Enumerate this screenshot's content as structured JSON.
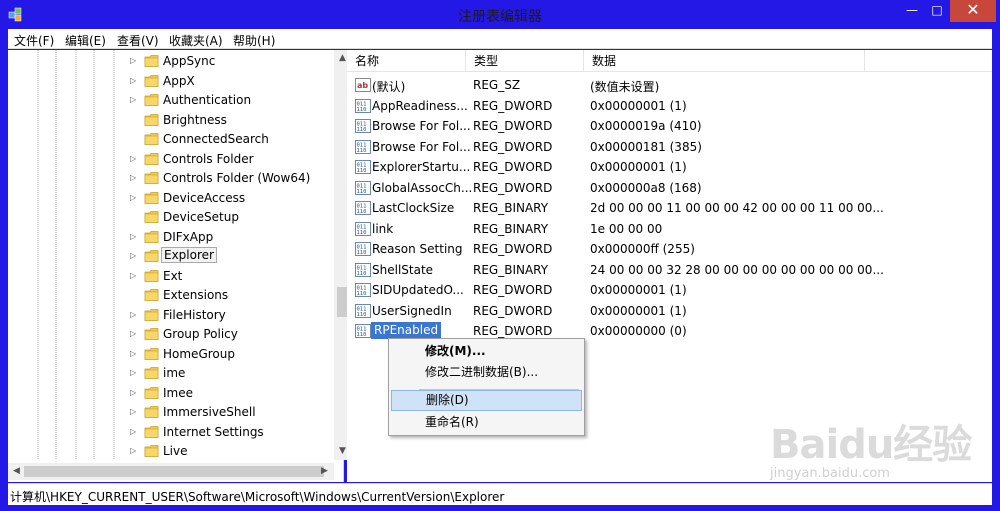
{
  "window": {
    "title": "注册表编辑器",
    "buttons": {
      "minimize": "—",
      "maximize": "□",
      "close": "✕"
    }
  },
  "menubar": {
    "items": [
      "文件(F)",
      "编辑(E)",
      "查看(V)",
      "收藏夹(A)",
      "帮助(H)"
    ]
  },
  "tree": {
    "items": [
      {
        "label": "AppSync",
        "expandable": true
      },
      {
        "label": "AppX",
        "expandable": true
      },
      {
        "label": "Authentication",
        "expandable": true
      },
      {
        "label": "Brightness",
        "expandable": false
      },
      {
        "label": "ConnectedSearch",
        "expandable": false
      },
      {
        "label": "Controls Folder",
        "expandable": true
      },
      {
        "label": "Controls Folder (Wow64)",
        "expandable": true
      },
      {
        "label": "DeviceAccess",
        "expandable": true
      },
      {
        "label": "DeviceSetup",
        "expandable": false
      },
      {
        "label": "DIFxApp",
        "expandable": true
      },
      {
        "label": "Explorer",
        "expandable": true,
        "selected": true
      },
      {
        "label": "Ext",
        "expandable": true
      },
      {
        "label": "Extensions",
        "expandable": false
      },
      {
        "label": "FileHistory",
        "expandable": true
      },
      {
        "label": "Group Policy",
        "expandable": true
      },
      {
        "label": "HomeGroup",
        "expandable": true
      },
      {
        "label": "ime",
        "expandable": true
      },
      {
        "label": "Imee",
        "expandable": true
      },
      {
        "label": "ImmersiveShell",
        "expandable": true
      },
      {
        "label": "Internet Settings",
        "expandable": true
      },
      {
        "label": "Live",
        "expandable": true
      }
    ]
  },
  "list": {
    "columns": [
      "名称",
      "类型",
      "数据"
    ],
    "rows": [
      {
        "icon": "string-value-icon",
        "name": "(默认)",
        "type": "REG_SZ",
        "data": "(数值未设置)"
      },
      {
        "icon": "binary-value-icon",
        "name": "AppReadiness...",
        "type": "REG_DWORD",
        "data": "0x00000001 (1)"
      },
      {
        "icon": "binary-value-icon",
        "name": "Browse For Fol...",
        "type": "REG_DWORD",
        "data": "0x0000019a (410)"
      },
      {
        "icon": "binary-value-icon",
        "name": "Browse For Fol...",
        "type": "REG_DWORD",
        "data": "0x00000181 (385)"
      },
      {
        "icon": "binary-value-icon",
        "name": "ExplorerStartu...",
        "type": "REG_DWORD",
        "data": "0x00000001 (1)"
      },
      {
        "icon": "binary-value-icon",
        "name": "GlobalAssocCh...",
        "type": "REG_DWORD",
        "data": "0x000000a8 (168)"
      },
      {
        "icon": "binary-value-icon",
        "name": "LastClockSize",
        "type": "REG_BINARY",
        "data": "2d 00 00 00 11 00 00 00 42 00 00 00 11 00 00..."
      },
      {
        "icon": "binary-value-icon",
        "name": "link",
        "type": "REG_BINARY",
        "data": "1e 00 00 00"
      },
      {
        "icon": "binary-value-icon",
        "name": "Reason Setting",
        "type": "REG_DWORD",
        "data": "0x000000ff (255)"
      },
      {
        "icon": "binary-value-icon",
        "name": "ShellState",
        "type": "REG_BINARY",
        "data": "24 00 00 00 32 28 00 00 00 00 00 00 00 00 00..."
      },
      {
        "icon": "binary-value-icon",
        "name": "SIDUpdatedO...",
        "type": "REG_DWORD",
        "data": "0x00000001 (1)"
      },
      {
        "icon": "binary-value-icon",
        "name": "UserSignedIn",
        "type": "REG_DWORD",
        "data": "0x00000001 (1)"
      },
      {
        "icon": "binary-value-icon",
        "name": "RPEnabled",
        "type": "REG_DWORD",
        "data": "0x00000000 (0)",
        "editing": true
      }
    ]
  },
  "context_menu": {
    "items": [
      {
        "label": "修改(M)...",
        "bold": true
      },
      {
        "label": "修改二进制数据(B)...",
        "bold": false
      },
      {
        "label": "删除(D)",
        "bold": false,
        "hover": true
      },
      {
        "label": "重命名(R)",
        "bold": false
      }
    ]
  },
  "statusbar": {
    "path": "计算机\\HKEY_CURRENT_USER\\Software\\Microsoft\\Windows\\CurrentVersion\\Explorer"
  },
  "watermark": {
    "brand": "Baidu经验",
    "url": "jingyan.baidu.com"
  },
  "colors": {
    "titlebar": "#2418e6",
    "close_button": "#c7483b",
    "selection": "#3b76d1",
    "menu_hover": "#cfe2f6"
  }
}
